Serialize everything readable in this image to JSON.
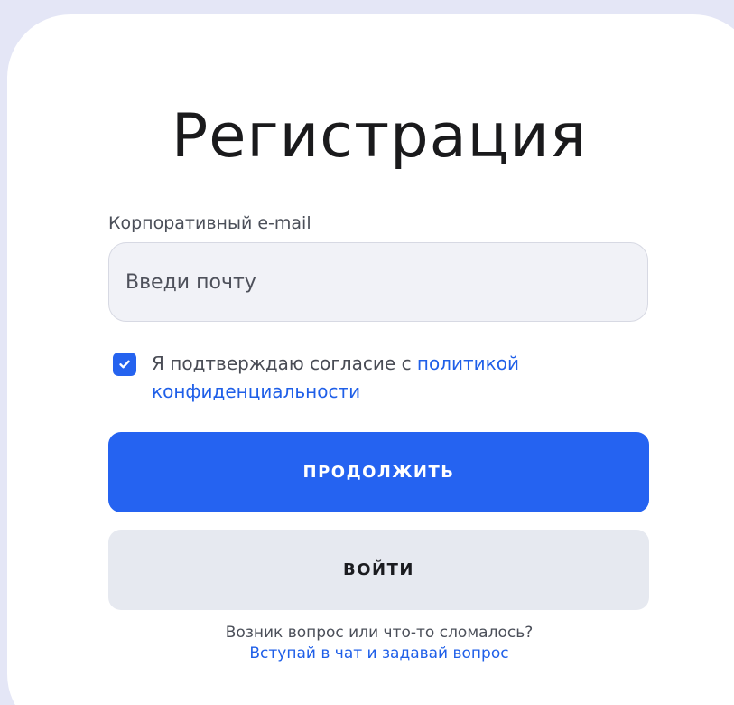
{
  "colors": {
    "accent": "#2563f1",
    "background": "#e4e6f6",
    "card": "#ffffff",
    "secondary_button": "#e6e9f0",
    "link": "#1f5fe8"
  },
  "form": {
    "title": "Регистрация",
    "email_label": "Корпоративный e-mail",
    "email_placeholder": "Введи почту",
    "email_value": "",
    "consent": {
      "checked": true,
      "text": "Я подтверждаю согласие с ",
      "link_text": "политикой конфиденциальности",
      "icon": "checkmark-icon"
    },
    "continue_label": "ПРОДОЛЖИТЬ",
    "login_label": "ВОЙТИ"
  },
  "footer": {
    "question": "Возник вопрос или что-то сломалось?",
    "chat_link": "Вступай в чат и задавай вопрос"
  }
}
